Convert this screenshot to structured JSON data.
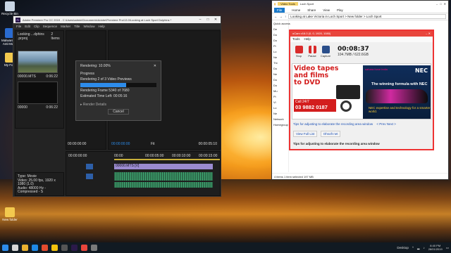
{
  "desktop": {
    "icons": [
      {
        "label": "Recycle Bin"
      },
      {
        "label": "Malwarebytes Anti-Mal..."
      },
      {
        "label": "My Fold"
      },
      {
        "label": "New folder"
      }
    ]
  },
  "premiere": {
    "title": "Adobe Premiere Pro CC 2019 - C:\\Users\\admin\\Documents\\Adobe\\Premiere Pro\\13.0\\Looking at Loch Sport Dolphins *",
    "menu": [
      "File",
      "Edit",
      "Clip",
      "Sequence",
      "Marker",
      "Title",
      "Window",
      "Help"
    ],
    "project_tab": "Looking ...dphins .prproj",
    "project_count": "2 Items",
    "clip1": "00000.MTS",
    "clip1_dur": "0:06:22",
    "clip2": "00000",
    "clip2_dur": "0:06:22",
    "dialog": {
      "title": "Rendering: 10.00%",
      "group": "Progress",
      "line1": "Rendering 2 of 3 Video Previews",
      "progress": 0.6,
      "line2": "Rendering Frame 5340 of 7680",
      "line3": "Estimated Time Left: 00:05:16",
      "details": "Render Details",
      "cancel": "Cancel"
    },
    "src_tc": "00:00:00:00",
    "prog_tc": "00:00:00:00",
    "prog_end": "00:00:05:10",
    "fit": "Fit",
    "seq_tc": "00:00:00:00",
    "ruler": [
      "00:00",
      "00:00:05:00",
      "00:00:10:00",
      "00:00:15:00"
    ],
    "v1_clip": "00000.MTS [V]",
    "info": [
      "Type: Movie",
      "Video: 25.00 fps, 1920 x 1080 (1.0)",
      "Audio: 48000 Hz - Compressed - S"
    ]
  },
  "explorer": {
    "ctx_tab": "Video Tools",
    "title": "Loch Sport",
    "tabs": [
      "File",
      "Home",
      "Share",
      "View",
      "Play"
    ],
    "address": "Looking at Lake Victoria in Loch Sport  >  New folder  >  Loch Sport",
    "nav": [
      "Quick access",
      "De",
      "Do",
      "Do",
      "Pi",
      "Lo",
      "Ne",
      "Thi",
      "Du",
      "Ne",
      "Do",
      "Do",
      "Mu",
      "Pi",
      "Vi",
      "Lo",
      "Ne",
      "Network",
      "Homegroup"
    ],
    "status": "4 items    1 item selected  197 MB"
  },
  "ocam": {
    "title": "oCam v16.0 (0, 0, 1920, 1080)",
    "menu": [
      "Tools",
      "Help"
    ],
    "buttons": [
      "Stop",
      "Pause",
      "Capture"
    ],
    "time": "00:08:37",
    "size": "104.7MB / 622.6GB",
    "ad_left": {
      "headline1": "Video tapes",
      "headline2": "and films",
      "headline3": "to DVD",
      "call": "Call 24/7",
      "phone": "03 9882 0187"
    },
    "ad_right": {
      "brand": "NEC",
      "team": "sahara force india",
      "tagline": "The winning formula with NEC",
      "sub": "NEC expertise and technology for a smarter world."
    },
    "tip1": "Tips for adjusting to elaborate the recording area window",
    "next": "< Prev Next >",
    "view_full": "View Full List",
    "website": "Ohsoft net",
    "tip2": "Tips for adjusting to elaborate the recording area window"
  },
  "taskbar": {
    "desktop_label": "Desktop",
    "time": "8:40 PM",
    "date": "28/01/2019"
  },
  "colors": {
    "premiere_accent": "#2d8ceb",
    "ocam_red": "#e8453c",
    "explorer_file": "#1979ca"
  }
}
